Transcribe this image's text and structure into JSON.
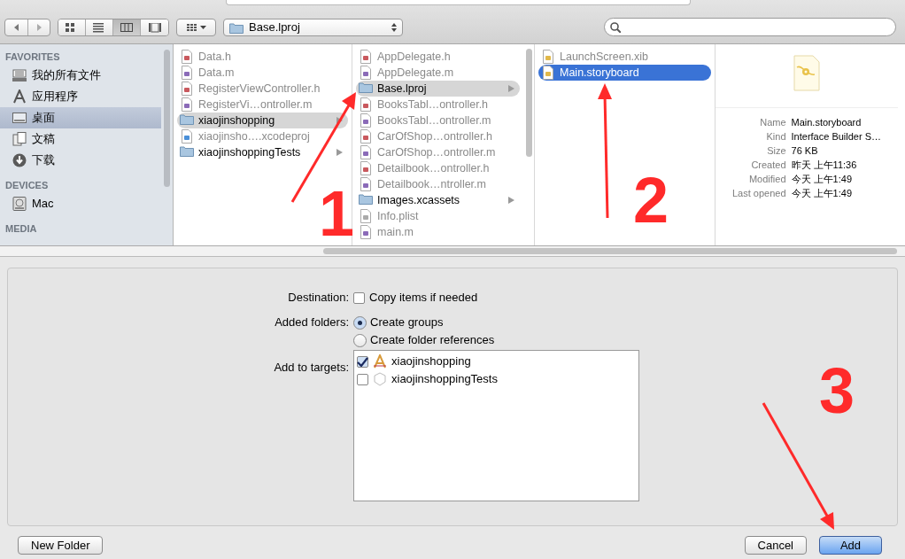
{
  "toolbar": {
    "view_buttons": [
      {
        "selected": false
      },
      {
        "selected": false
      },
      {
        "selected": true
      },
      {
        "selected": false
      }
    ],
    "path_popup": "Base.lproj"
  },
  "sidebar": [
    {
      "heading": "FAVORITES",
      "items": [
        {
          "label": "我的所有文件",
          "kind": "files",
          "selected": false
        },
        {
          "label": "应用程序",
          "kind": "apps",
          "selected": false
        },
        {
          "label": "桌面",
          "kind": "desktop",
          "selected": true
        },
        {
          "label": "文稿",
          "kind": "docs",
          "selected": false
        },
        {
          "label": "下载",
          "kind": "download",
          "selected": false
        }
      ]
    },
    {
      "heading": "DEVICES",
      "items": [
        {
          "label": "Mac",
          "kind": "disk",
          "selected": false
        }
      ]
    },
    {
      "heading": "MEDIA"
    }
  ],
  "columns": [
    {
      "focused": false,
      "items": [
        {
          "name": "Data.h",
          "kind": "h",
          "disabled": true,
          "selected": false
        },
        {
          "name": "Data.m",
          "kind": "m",
          "disabled": true,
          "selected": false
        },
        {
          "name": "RegisterViewController.h",
          "kind": "h",
          "disabled": true,
          "selected": false
        },
        {
          "name": "RegisterVi…ontroller.m",
          "kind": "m",
          "disabled": true,
          "selected": false
        },
        {
          "name": "xiaojinshopping",
          "kind": "folder",
          "disabled": false,
          "selected": true
        },
        {
          "name": "xiaojinsho….xcodeproj",
          "kind": "project",
          "disabled": true,
          "selected": false
        },
        {
          "name": "xiaojinshoppingTests",
          "kind": "folder",
          "disabled": false,
          "selected": false
        }
      ]
    },
    {
      "focused": false,
      "items": [
        {
          "name": "AppDelegate.h",
          "kind": "h",
          "disabled": true,
          "selected": false
        },
        {
          "name": "AppDelegate.m",
          "kind": "m",
          "disabled": true,
          "selected": false
        },
        {
          "name": "Base.lproj",
          "kind": "folder",
          "disabled": false,
          "selected": true
        },
        {
          "name": "BooksTabl…ontroller.h",
          "kind": "h",
          "disabled": true,
          "selected": false
        },
        {
          "name": "BooksTabl…ontroller.m",
          "kind": "m",
          "disabled": true,
          "selected": false
        },
        {
          "name": "CarOfShop…ontroller.h",
          "kind": "h",
          "disabled": true,
          "selected": false
        },
        {
          "name": "CarOfShop…ontroller.m",
          "kind": "m",
          "disabled": true,
          "selected": false
        },
        {
          "name": "Detailbook…ontroller.h",
          "kind": "h",
          "disabled": true,
          "selected": false
        },
        {
          "name": "Detailbook…ntroller.m",
          "kind": "m",
          "disabled": true,
          "selected": false
        },
        {
          "name": "Images.xcassets",
          "kind": "folder",
          "disabled": false,
          "selected": false
        },
        {
          "name": "Info.plist",
          "kind": "plist",
          "disabled": true,
          "selected": false
        },
        {
          "name": "main.m",
          "kind": "m",
          "disabled": true,
          "selected": false
        }
      ]
    },
    {
      "focused": true,
      "items": [
        {
          "name": "LaunchScreen.xib",
          "kind": "xib",
          "disabled": true,
          "selected": false
        },
        {
          "name": "Main.storyboard",
          "kind": "storyboard",
          "disabled": false,
          "selected": true
        }
      ]
    }
  ],
  "preview": {
    "rows": [
      {
        "label": "Name",
        "value": "Main.storyboard"
      },
      {
        "label": "Kind",
        "value": "Interface Builder S…"
      },
      {
        "label": "Size",
        "value": "76 KB"
      },
      {
        "label": "Created",
        "value": "昨天 上午11:36"
      },
      {
        "label": "Modified",
        "value": "今天 上午1:49"
      },
      {
        "label": "Last opened",
        "value": "今天 上午1:49"
      }
    ]
  },
  "options": {
    "destination": {
      "label": "Destination:",
      "checkbox": {
        "label": "Copy items if needed",
        "checked": false
      }
    },
    "added_folders": {
      "label": "Added folders:",
      "radios": [
        {
          "label": "Create groups",
          "selected": true
        },
        {
          "label": "Create folder references",
          "selected": false
        }
      ]
    },
    "targets": {
      "label": "Add to targets:",
      "items": [
        {
          "name": "xiaojinshopping",
          "kind": "app",
          "checked": true
        },
        {
          "name": "xiaojinshoppingTests",
          "kind": "tests",
          "checked": false
        }
      ]
    }
  },
  "buttons": {
    "left": "New Folder",
    "cancel": "Cancel",
    "default": "Add"
  },
  "annotations": [
    "1",
    "2",
    "3"
  ]
}
